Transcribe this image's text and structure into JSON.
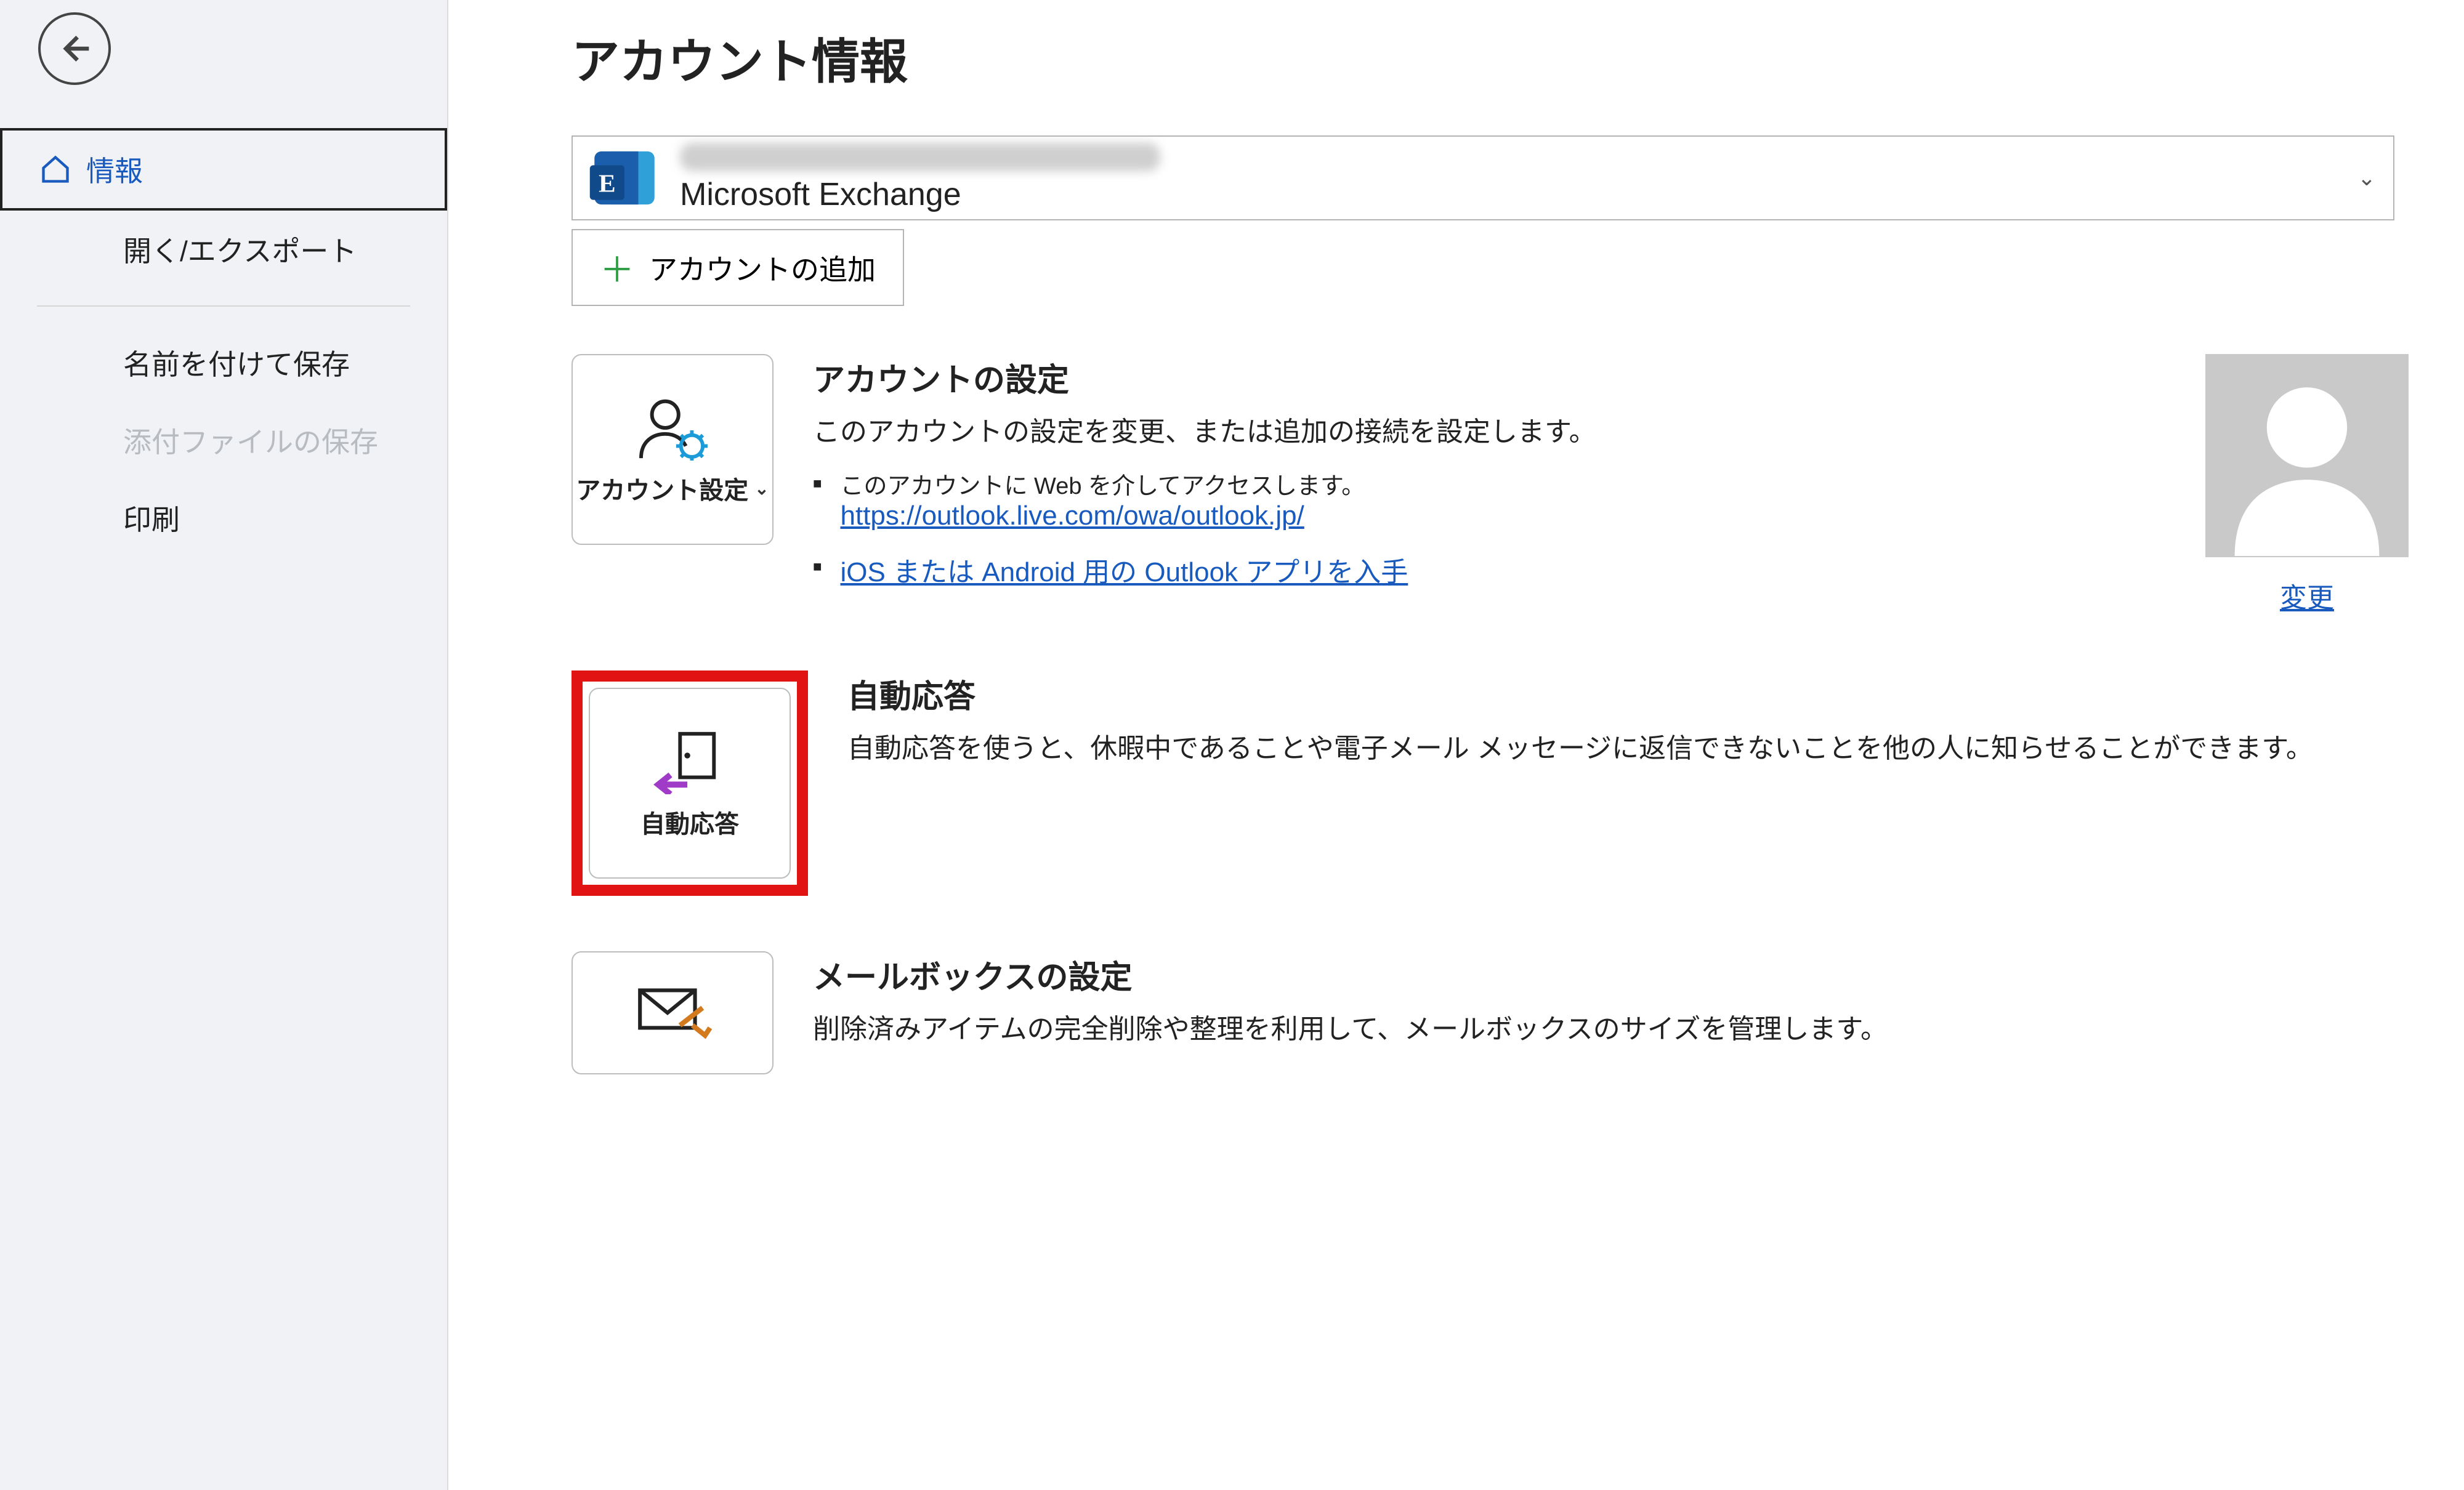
{
  "sidebar": {
    "items": [
      {
        "label": "情報"
      },
      {
        "label": "開く/エクスポート"
      },
      {
        "label": "名前を付けて保存"
      },
      {
        "label": "添付ファイルの保存"
      },
      {
        "label": "印刷"
      }
    ]
  },
  "page": {
    "title": "アカウント情報"
  },
  "account": {
    "type": "Microsoft Exchange",
    "add_label": "アカウントの追加"
  },
  "tiles": {
    "settings_label": "アカウント設定",
    "auto_reply_label": "自動応答",
    "mailbox_label": "メールボックスの設定"
  },
  "sections": {
    "settings": {
      "title": "アカウントの設定",
      "desc": "このアカウントの設定を変更、または追加の接続を設定します。",
      "bullet1_prefix": "このアカウントに Web を介してアクセスします。",
      "bullet1_link": "https://outlook.live.com/owa/outlook.jp/",
      "bullet2_link": "iOS または Android 用の Outlook アプリを入手"
    },
    "auto_reply": {
      "title": "自動応答",
      "desc": "自動応答を使うと、休暇中であることや電子メール メッセージに返信できないことを他の人に知らせることができます。"
    },
    "mailbox": {
      "title": "メールボックスの設定",
      "desc": "削除済みアイテムの完全削除や整理を利用して、メールボックスのサイズを管理します。"
    }
  },
  "avatar": {
    "change_label": "変更"
  }
}
